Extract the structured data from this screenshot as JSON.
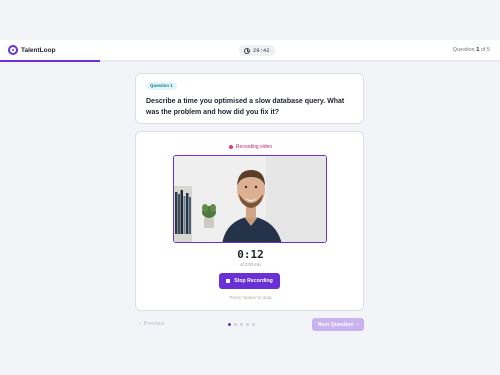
{
  "header": {
    "brand_name": "TalentLoop",
    "timer": "29:42",
    "question_prefix": "Question",
    "question_current": "1",
    "question_of": "of 5",
    "progress_fraction": 0.2,
    "accent_color": "#6b2fd6"
  },
  "question": {
    "badge": "Question 1",
    "text": "Describe a time you optimised a slow database query. What was the problem and how did you fix it?"
  },
  "recording": {
    "status_label": "Recording video",
    "elapsed": "0:12",
    "limit": "of 2:00 min",
    "stop_label": "Stop Recording",
    "hint": "Press 'Space' to stop"
  },
  "footer": {
    "previous_label": "Previous",
    "next_label": "Next Question",
    "step_count": 5,
    "active_step": 1
  },
  "icons": {
    "brand": "talentloop-logo-icon",
    "timer": "clock-icon",
    "record": "recording-dot-icon",
    "stop": "stop-icon",
    "previous": "chevron-left-icon",
    "next": "chevron-right-icon"
  }
}
